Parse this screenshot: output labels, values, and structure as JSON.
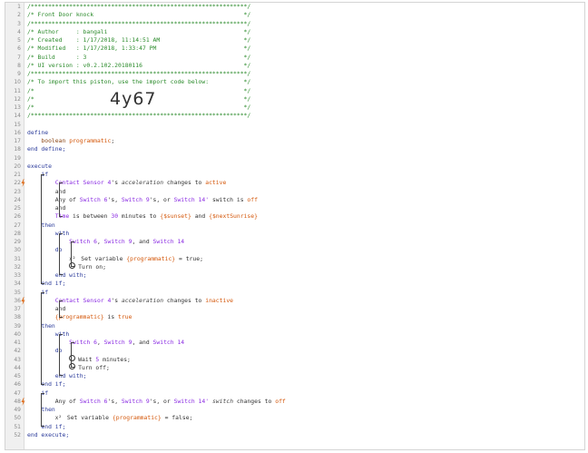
{
  "import_code": "4y67",
  "lines": [
    {
      "n": "1",
      "t": [
        {
          "c": "comment",
          "s": "/**************************************************************/"
        }
      ]
    },
    {
      "n": "2",
      "t": [
        {
          "c": "comment",
          "s": "/* Front Door knock                                           */"
        }
      ]
    },
    {
      "n": "3",
      "t": [
        {
          "c": "comment",
          "s": "/**************************************************************/"
        }
      ]
    },
    {
      "n": "4",
      "t": [
        {
          "c": "comment",
          "s": "/* Author     : bangali                                       */"
        }
      ]
    },
    {
      "n": "5",
      "t": [
        {
          "c": "comment",
          "s": "/* Created    : 1/17/2018, 11:14:51 AM                        */"
        }
      ]
    },
    {
      "n": "6",
      "t": [
        {
          "c": "comment",
          "s": "/* Modified   : 1/17/2018, 1:33:47 PM                         */"
        }
      ]
    },
    {
      "n": "7",
      "t": [
        {
          "c": "comment",
          "s": "/* Build      : 3                                             */"
        }
      ]
    },
    {
      "n": "8",
      "t": [
        {
          "c": "comment",
          "s": "/* UI version : v0.2.102.20180116                             */"
        }
      ]
    },
    {
      "n": "9",
      "t": [
        {
          "c": "comment",
          "s": "/**************************************************************/"
        }
      ]
    },
    {
      "n": "10",
      "t": [
        {
          "c": "comment",
          "s": "/* To import this piston, use the import code below:          */"
        }
      ]
    },
    {
      "n": "11",
      "t": [
        {
          "c": "comment",
          "s": "/*                                                            */"
        }
      ]
    },
    {
      "n": "12",
      "t": [
        {
          "c": "comment",
          "s": "/*                                                            */"
        }
      ]
    },
    {
      "n": "13",
      "t": [
        {
          "c": "comment",
          "s": "/*                                                            */"
        }
      ]
    },
    {
      "n": "14",
      "t": [
        {
          "c": "comment",
          "s": "/**************************************************************/"
        }
      ]
    },
    {
      "n": "15",
      "t": []
    },
    {
      "n": "16",
      "t": [
        {
          "c": "kw",
          "s": "define"
        }
      ]
    },
    {
      "n": "17",
      "t": [
        {
          "c": "plain",
          "s": "    "
        },
        {
          "c": "type",
          "s": "boolean"
        },
        {
          "c": "plain",
          "s": " "
        },
        {
          "c": "var",
          "s": "programmatic"
        },
        {
          "c": "plain",
          "s": ";"
        }
      ]
    },
    {
      "n": "18",
      "t": [
        {
          "c": "kw",
          "s": "end define;"
        }
      ]
    },
    {
      "n": "19",
      "t": []
    },
    {
      "n": "20",
      "t": [
        {
          "c": "kw",
          "s": "execute"
        }
      ]
    },
    {
      "n": "21",
      "t": [
        {
          "c": "plain",
          "s": "    "
        },
        {
          "c": "kw",
          "s": "if"
        }
      ]
    },
    {
      "n": "22",
      "t": [
        {
          "c": "plain",
          "s": "        "
        },
        {
          "c": "device",
          "s": "Contact Sensor 4"
        },
        {
          "c": "plain",
          "s": "'s "
        },
        {
          "c": "attr",
          "s": "acceleration"
        },
        {
          "c": "plain",
          "s": " changes to "
        },
        {
          "c": "str",
          "s": "active"
        }
      ],
      "bolt": true
    },
    {
      "n": "23",
      "t": [
        {
          "c": "plain",
          "s": "        and"
        }
      ]
    },
    {
      "n": "24",
      "t": [
        {
          "c": "plain",
          "s": "        Any of "
        },
        {
          "c": "device",
          "s": "Switch 6"
        },
        {
          "c": "plain",
          "s": "'s, "
        },
        {
          "c": "device",
          "s": "Switch 9"
        },
        {
          "c": "plain",
          "s": "'s, or "
        },
        {
          "c": "device",
          "s": "Switch 14'"
        },
        {
          "c": "plain",
          "s": " switch is "
        },
        {
          "c": "str",
          "s": "off"
        }
      ]
    },
    {
      "n": "25",
      "t": [
        {
          "c": "plain",
          "s": "        and"
        }
      ]
    },
    {
      "n": "26",
      "t": [
        {
          "c": "plain",
          "s": "        "
        },
        {
          "c": "device",
          "s": "Time"
        },
        {
          "c": "plain",
          "s": " is between "
        },
        {
          "c": "num",
          "s": "30"
        },
        {
          "c": "plain",
          "s": " minutes to "
        },
        {
          "c": "str",
          "s": "{$sunset}"
        },
        {
          "c": "plain",
          "s": " and "
        },
        {
          "c": "str",
          "s": "{$nextSunrise}"
        }
      ]
    },
    {
      "n": "27",
      "t": [
        {
          "c": "plain",
          "s": "    "
        },
        {
          "c": "kw",
          "s": "then"
        }
      ]
    },
    {
      "n": "28",
      "t": [
        {
          "c": "plain",
          "s": "        "
        },
        {
          "c": "kw",
          "s": "with"
        }
      ]
    },
    {
      "n": "29",
      "t": [
        {
          "c": "plain",
          "s": "            "
        },
        {
          "c": "device",
          "s": "Switch 6"
        },
        {
          "c": "plain",
          "s": ", "
        },
        {
          "c": "device",
          "s": "Switch 9"
        },
        {
          "c": "plain",
          "s": ", and "
        },
        {
          "c": "device",
          "s": "Switch 14"
        }
      ]
    },
    {
      "n": "30",
      "t": [
        {
          "c": "plain",
          "s": "        "
        },
        {
          "c": "kw",
          "s": "do"
        }
      ]
    },
    {
      "n": "31",
      "t": [
        {
          "c": "plain",
          "s": "            "
        },
        {
          "c": "icon",
          "s": "x²"
        },
        {
          "c": "plain",
          "s": " Set variable "
        },
        {
          "c": "var",
          "s": "{programmatic}"
        },
        {
          "c": "plain",
          "s": " = true;"
        }
      ]
    },
    {
      "n": "32",
      "t": [
        {
          "c": "plain",
          "s": "            "
        },
        {
          "c": "power",
          "s": ""
        },
        {
          "c": "plain",
          "s": "Turn on;"
        }
      ]
    },
    {
      "n": "33",
      "t": [
        {
          "c": "plain",
          "s": "        "
        },
        {
          "c": "kw",
          "s": "end with;"
        }
      ]
    },
    {
      "n": "34",
      "t": [
        {
          "c": "plain",
          "s": "    "
        },
        {
          "c": "kw",
          "s": "end if;"
        }
      ]
    },
    {
      "n": "35",
      "t": [
        {
          "c": "plain",
          "s": "    "
        },
        {
          "c": "kw",
          "s": "if"
        }
      ]
    },
    {
      "n": "36",
      "t": [
        {
          "c": "plain",
          "s": "        "
        },
        {
          "c": "device",
          "s": "Contact Sensor 4"
        },
        {
          "c": "plain",
          "s": "'s "
        },
        {
          "c": "attr",
          "s": "acceleration"
        },
        {
          "c": "plain",
          "s": " changes to "
        },
        {
          "c": "str",
          "s": "inactive"
        }
      ],
      "bolt": true
    },
    {
      "n": "37",
      "t": [
        {
          "c": "plain",
          "s": "        and"
        }
      ]
    },
    {
      "n": "38",
      "t": [
        {
          "c": "plain",
          "s": "        "
        },
        {
          "c": "var",
          "s": "{programmatic}"
        },
        {
          "c": "plain",
          "s": " is "
        },
        {
          "c": "str",
          "s": "true"
        }
      ]
    },
    {
      "n": "39",
      "t": [
        {
          "c": "plain",
          "s": "    "
        },
        {
          "c": "kw",
          "s": "then"
        }
      ]
    },
    {
      "n": "40",
      "t": [
        {
          "c": "plain",
          "s": "        "
        },
        {
          "c": "kw",
          "s": "with"
        }
      ]
    },
    {
      "n": "41",
      "t": [
        {
          "c": "plain",
          "s": "            "
        },
        {
          "c": "device",
          "s": "Switch 6"
        },
        {
          "c": "plain",
          "s": ", "
        },
        {
          "c": "device",
          "s": "Switch 9"
        },
        {
          "c": "plain",
          "s": ", and "
        },
        {
          "c": "device",
          "s": "Switch 14"
        }
      ]
    },
    {
      "n": "42",
      "t": [
        {
          "c": "plain",
          "s": "        "
        },
        {
          "c": "kw",
          "s": "do"
        }
      ]
    },
    {
      "n": "43",
      "t": [
        {
          "c": "plain",
          "s": "            "
        },
        {
          "c": "clock",
          "s": ""
        },
        {
          "c": "plain",
          "s": "Wait "
        },
        {
          "c": "num",
          "s": "5"
        },
        {
          "c": "plain",
          "s": " minutes;"
        }
      ]
    },
    {
      "n": "44",
      "t": [
        {
          "c": "plain",
          "s": "            "
        },
        {
          "c": "power",
          "s": ""
        },
        {
          "c": "plain",
          "s": "Turn off;"
        }
      ]
    },
    {
      "n": "45",
      "t": [
        {
          "c": "plain",
          "s": "        "
        },
        {
          "c": "kw",
          "s": "end with;"
        }
      ]
    },
    {
      "n": "46",
      "t": [
        {
          "c": "plain",
          "s": "    "
        },
        {
          "c": "kw",
          "s": "end if;"
        }
      ]
    },
    {
      "n": "47",
      "t": [
        {
          "c": "plain",
          "s": "    "
        },
        {
          "c": "kw",
          "s": "if"
        }
      ]
    },
    {
      "n": "48",
      "t": [
        {
          "c": "plain",
          "s": "        Any of "
        },
        {
          "c": "device",
          "s": "Switch 6"
        },
        {
          "c": "plain",
          "s": "'s, "
        },
        {
          "c": "device",
          "s": "Switch 9"
        },
        {
          "c": "plain",
          "s": "'s, or "
        },
        {
          "c": "device",
          "s": "Switch 14'"
        },
        {
          "c": "plain",
          "s": " "
        },
        {
          "c": "attr",
          "s": "switch"
        },
        {
          "c": "plain",
          "s": " changes to "
        },
        {
          "c": "str",
          "s": "off"
        }
      ],
      "bolt": true
    },
    {
      "n": "49",
      "t": [
        {
          "c": "plain",
          "s": "    "
        },
        {
          "c": "kw",
          "s": "then"
        }
      ]
    },
    {
      "n": "50",
      "t": [
        {
          "c": "plain",
          "s": "        "
        },
        {
          "c": "icon",
          "s": "x²"
        },
        {
          "c": "plain",
          "s": " Set variable "
        },
        {
          "c": "var",
          "s": "{programmatic}"
        },
        {
          "c": "plain",
          "s": " = false;"
        }
      ]
    },
    {
      "n": "51",
      "t": [
        {
          "c": "plain",
          "s": "    "
        },
        {
          "c": "kw",
          "s": "end if;"
        }
      ]
    },
    {
      "n": "52",
      "t": [
        {
          "c": "kw",
          "s": "end execute;"
        }
      ]
    }
  ]
}
